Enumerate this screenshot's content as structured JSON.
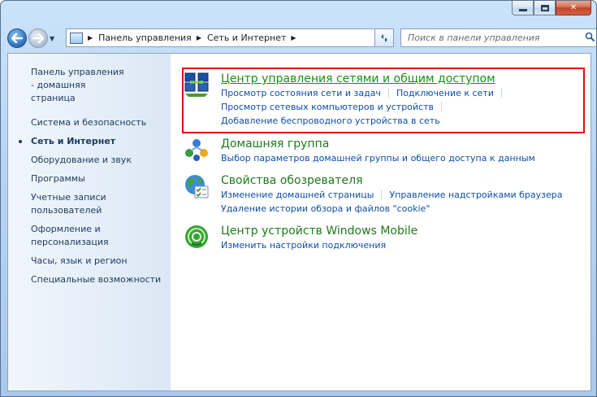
{
  "window": {
    "buttons": {
      "minimize": "minimize",
      "maximize": "maximize",
      "close": "✕"
    }
  },
  "navbar": {
    "back_icon": "back-arrow-icon",
    "forward_icon": "forward-arrow-icon",
    "breadcrumb": [
      "Панель управления",
      "Сеть и Интернет"
    ],
    "search": {
      "placeholder": "Поиск в панели управления"
    }
  },
  "sidebar": {
    "items": [
      {
        "label": "Панель управления - домашняя страница",
        "active": false
      },
      {
        "label": "Система и безопасность",
        "active": false
      },
      {
        "label": "Сеть и Интернет",
        "active": true
      },
      {
        "label": "Оборудование и звук",
        "active": false
      },
      {
        "label": "Программы",
        "active": false
      },
      {
        "label": "Учетные записи пользователей",
        "active": false
      },
      {
        "label": "Оформление и персонализация",
        "active": false
      },
      {
        "label": "Часы, язык и регион",
        "active": false
      },
      {
        "label": "Специальные возможности",
        "active": false
      }
    ]
  },
  "categories": [
    {
      "title": "Центр управления сетями и общим доступом",
      "icon": "network-center-icon",
      "links": [
        [
          "Просмотр состояния сети и задач",
          "Подключение к сети"
        ],
        [
          "Просмотр сетевых компьютеров и устройств"
        ],
        [
          "Добавление беспроводного устройства в сеть"
        ]
      ]
    },
    {
      "title": "Домашняя группа",
      "icon": "homegroup-icon",
      "links": [
        [
          "Выбор параметров домашней группы и общего доступа к данным"
        ]
      ]
    },
    {
      "title": "Свойства обозревателя",
      "icon": "internet-options-icon",
      "links": [
        [
          "Изменение домашней страницы",
          "Управление надстройками браузера"
        ],
        [
          "Удаление истории обзора и файлов \"cookie\""
        ]
      ]
    },
    {
      "title": "Центр устройств Windows Mobile",
      "icon": "windows-mobile-icon",
      "links": [
        [
          "Изменить настройки подключения"
        ]
      ]
    }
  ],
  "colors": {
    "category_title": "#1d7a1d",
    "link": "#0d4ea6",
    "highlight_border": "#e00a0a"
  }
}
